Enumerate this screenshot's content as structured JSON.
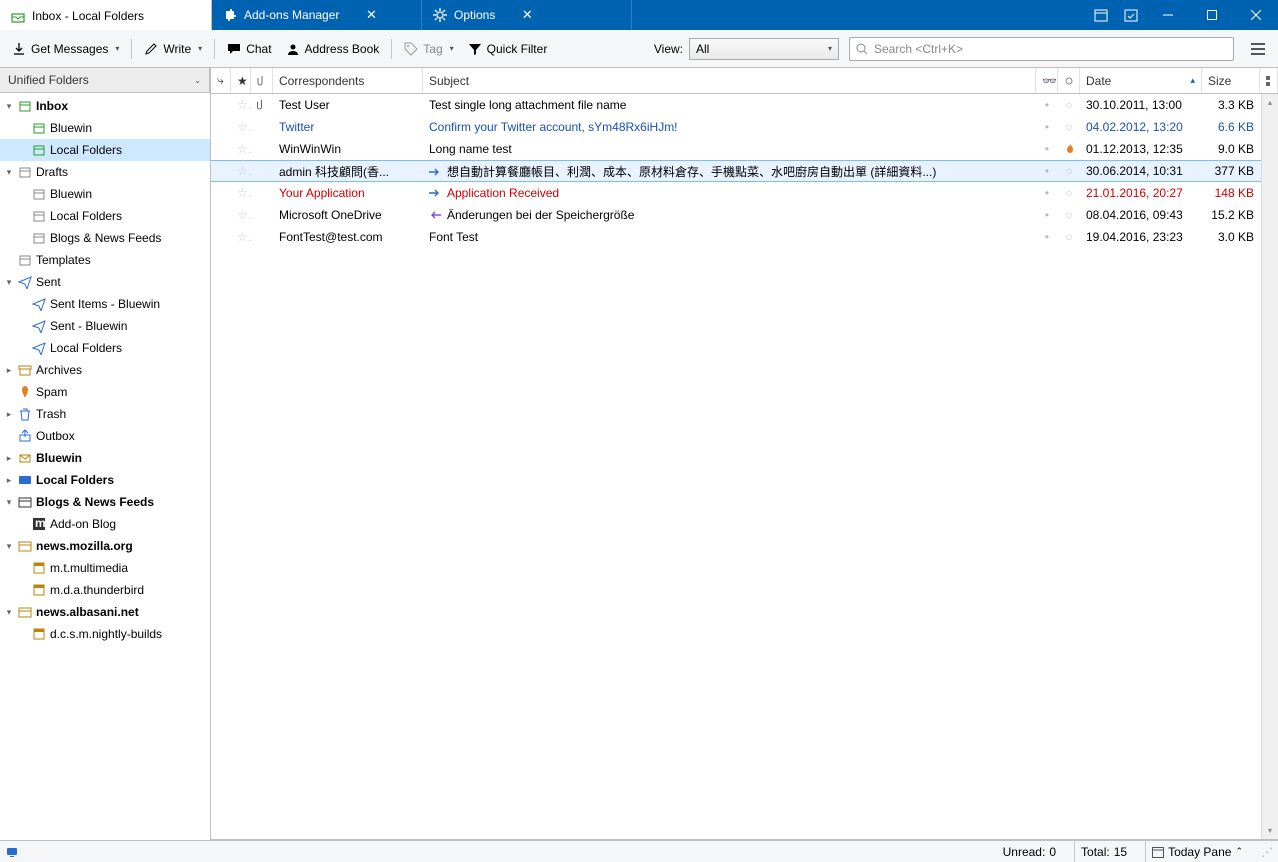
{
  "tabs": [
    {
      "label": "Inbox - Local Folders",
      "icon": "inbox-icon"
    },
    {
      "label": "Add-ons Manager",
      "icon": "puzzle-icon"
    },
    {
      "label": "Options",
      "icon": "gear-icon"
    }
  ],
  "toolbar": {
    "get_messages": "Get Messages",
    "write": "Write",
    "chat": "Chat",
    "address_book": "Address Book",
    "tag": "Tag",
    "quick_filter": "Quick Filter",
    "view_label": "View:",
    "view_value": "All",
    "search_placeholder": "Search <Ctrl+K>"
  },
  "sidebar_header": "Unified Folders",
  "tree": [
    {
      "lvl": 0,
      "tw": "▾",
      "icon": "inbox",
      "label": "Inbox",
      "bold": true
    },
    {
      "lvl": 1,
      "tw": "",
      "icon": "inbox",
      "label": "Bluewin"
    },
    {
      "lvl": 1,
      "tw": "",
      "icon": "inbox",
      "label": "Local Folders",
      "sel": true
    },
    {
      "lvl": 0,
      "tw": "▾",
      "icon": "drafts",
      "label": "Drafts"
    },
    {
      "lvl": 1,
      "tw": "",
      "icon": "drafts",
      "label": "Bluewin"
    },
    {
      "lvl": 1,
      "tw": "",
      "icon": "drafts",
      "label": "Local Folders"
    },
    {
      "lvl": 1,
      "tw": "",
      "icon": "drafts",
      "label": "Blogs & News Feeds"
    },
    {
      "lvl": 0,
      "tw": "",
      "icon": "templates",
      "label": "Templates"
    },
    {
      "lvl": 0,
      "tw": "▾",
      "icon": "sent",
      "label": "Sent"
    },
    {
      "lvl": 1,
      "tw": "",
      "icon": "sent",
      "label": "Sent Items - Bluewin"
    },
    {
      "lvl": 1,
      "tw": "",
      "icon": "sent",
      "label": "Sent - Bluewin"
    },
    {
      "lvl": 1,
      "tw": "",
      "icon": "sent",
      "label": "Local Folders"
    },
    {
      "lvl": 0,
      "tw": "▸",
      "icon": "archive",
      "label": "Archives"
    },
    {
      "lvl": 0,
      "tw": "",
      "icon": "spam",
      "label": "Spam"
    },
    {
      "lvl": 0,
      "tw": "▸",
      "icon": "trash",
      "label": "Trash"
    },
    {
      "lvl": 0,
      "tw": "",
      "icon": "outbox",
      "label": "Outbox"
    },
    {
      "lvl": 0,
      "tw": "▸",
      "icon": "account",
      "label": "Bluewin",
      "bold": true
    },
    {
      "lvl": 0,
      "tw": "▸",
      "icon": "local",
      "label": "Local Folders",
      "bold": true
    },
    {
      "lvl": 0,
      "tw": "▾",
      "icon": "rss",
      "label": "Blogs & News Feeds",
      "bold": true
    },
    {
      "lvl": 1,
      "tw": "",
      "icon": "rssitem",
      "label": "Add-on Blog"
    },
    {
      "lvl": 0,
      "tw": "▾",
      "icon": "news",
      "label": "news.mozilla.org",
      "bold": true
    },
    {
      "lvl": 1,
      "tw": "",
      "icon": "newsgroup",
      "label": "m.t.multimedia"
    },
    {
      "lvl": 1,
      "tw": "",
      "icon": "newsgroup",
      "label": "m.d.a.thunderbird"
    },
    {
      "lvl": 0,
      "tw": "▾",
      "icon": "news",
      "label": "news.albasani.net",
      "bold": true
    },
    {
      "lvl": 1,
      "tw": "",
      "icon": "newsgroup",
      "label": "d.c.s.m.nightly-builds"
    }
  ],
  "columns": {
    "correspondents": "Correspondents",
    "subject": "Subject",
    "date": "Date",
    "size": "Size"
  },
  "messages": [
    {
      "from": "Test User",
      "subj": "Test single long attachment file name",
      "date": "30.10.2011, 13:00",
      "size": "3.3 KB",
      "attach": true
    },
    {
      "from": "Twitter",
      "subj": "Confirm your Twitter account, sYm48Rx6iHJm!",
      "date": "04.02.2012, 13:20",
      "size": "6.6 KB",
      "style": "link"
    },
    {
      "from": "WinWinWin",
      "subj": "Long name test",
      "date": "01.12.2013, 12:35",
      "size": "9.0 KB",
      "flag": "fire"
    },
    {
      "from": "admin 科技顧問(香...",
      "subj": "想自動計算餐廳帳目、利潤、成本、原材料倉存、手機點菜、水吧廚房自動出單 (詳細資料...)",
      "date": "30.06.2014, 10:31",
      "size": "377 KB",
      "sel": true,
      "subicon": "fwd"
    },
    {
      "from": "Your Application",
      "subj": "Application Received",
      "date": "21.01.2016, 20:27",
      "size": "148 KB",
      "style": "red",
      "subicon": "fwd"
    },
    {
      "from": "Microsoft OneDrive",
      "subj": "Änderungen bei der Speichergröße",
      "date": "08.04.2016, 09:43",
      "size": "15.2 KB",
      "subicon": "reply"
    },
    {
      "from": "FontTest@test.com",
      "subj": "Font Test",
      "date": "19.04.2016, 23:23",
      "size": "3.0 KB"
    }
  ],
  "status": {
    "unread_label": "Unread:",
    "unread": "0",
    "total_label": "Total:",
    "total": "15",
    "today_pane": "Today Pane"
  }
}
